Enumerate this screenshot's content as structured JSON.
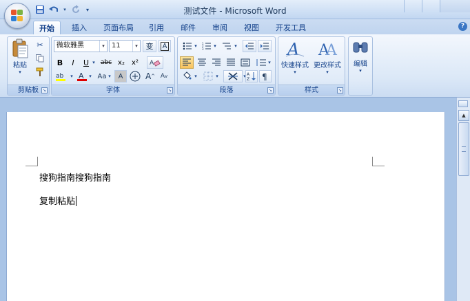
{
  "window": {
    "title": "测试文件 - Microsoft Word"
  },
  "qat": {
    "save_icon": "save-icon",
    "undo_icon": "undo-icon",
    "redo_icon": "redo-icon"
  },
  "tabs": [
    {
      "label": "开始",
      "active": true
    },
    {
      "label": "插入"
    },
    {
      "label": "页面布局"
    },
    {
      "label": "引用"
    },
    {
      "label": "邮件"
    },
    {
      "label": "审阅"
    },
    {
      "label": "视图"
    },
    {
      "label": "开发工具"
    }
  ],
  "clipboard": {
    "paste_label": "粘贴",
    "group_label": "剪贴板"
  },
  "font": {
    "font_name": "微软雅黑",
    "font_size": "11",
    "wen_label": "变",
    "a_box_label": "A",
    "bold": "B",
    "italic": "I",
    "underline": "U",
    "strike": "abc",
    "subscript": "x₂",
    "superscript": "x²",
    "change_case": "Aa",
    "char_shade": "A",
    "enclose": "字",
    "grow": "A",
    "shrink": "A",
    "group_label": "字体"
  },
  "paragraph": {
    "group_label": "段落"
  },
  "styles": {
    "quick_styles_label": "快速样式",
    "change_styles_label": "更改样式",
    "group_label": "样式"
  },
  "editing": {
    "label": "编辑"
  },
  "document": {
    "line1": "搜狗指南搜狗指南",
    "line2": "复制粘贴"
  },
  "colors": {
    "ribbon_bg": "#dbe8f7",
    "accent": "#15428b",
    "highlight": "#f9c35e"
  }
}
